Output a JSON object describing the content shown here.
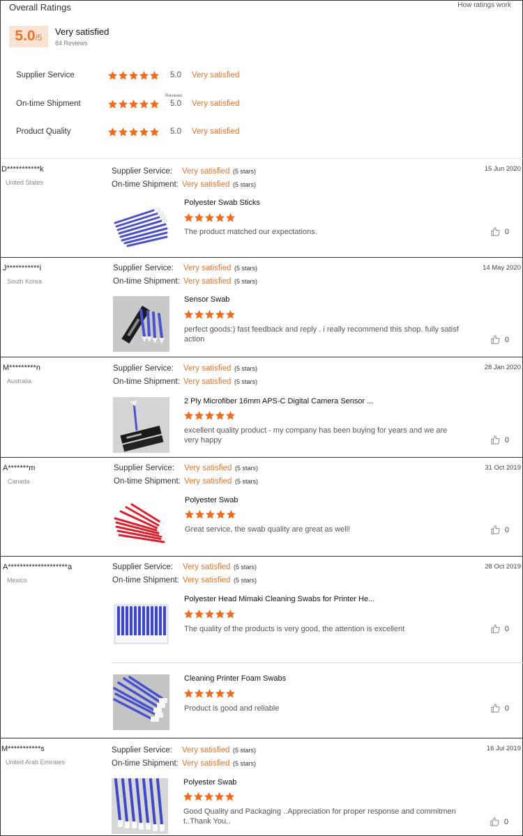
{
  "overall": {
    "title": "Overall Ratings",
    "help_link": "How ratings work",
    "score": "5.0",
    "score_of": "/5",
    "satisfaction": "Very satisfied",
    "review_count": "84 Reviews",
    "reviews_tooltip": "Reviews",
    "rating_fraction": 1.0,
    "categories": [
      {
        "label": "Supplier Service",
        "score": "5.0",
        "satisfaction": "Very satisfied",
        "rating": 5
      },
      {
        "label": "On-time Shipment",
        "score": "5.0",
        "satisfaction": "Very satisfied",
        "rating": 5
      },
      {
        "label": "Product Quality",
        "score": "5.0",
        "satisfaction": "Very satisfied",
        "rating": 5
      }
    ]
  },
  "colors": {
    "accent": "#e8732a",
    "star": "#f26b1d",
    "score_bg": "#fbe3d4"
  },
  "icons": {
    "star": "star-icon",
    "like": "thumbs-up-icon"
  },
  "sub_labels": {
    "supplier": "Supplier Service:",
    "shipment": "On-time Shipment:"
  },
  "reviews": [
    {
      "reviewer": "D***********k",
      "country": "United States",
      "date": "15 Jun 2020",
      "supplier_sat": "Very satisfied",
      "supplier_stars": "(5 stars)",
      "shipment_sat": "Very satisfied",
      "shipment_stars": "(5 stars)",
      "items": [
        {
          "title": "Polyester Swab Sticks",
          "rating": 5,
          "text": "The product matched our expectations.",
          "likes": "0"
        }
      ]
    },
    {
      "reviewer": "J***********i",
      "country": "South Korea",
      "date": "14 May 2020",
      "supplier_sat": "Very satisfied",
      "supplier_stars": "(5 stars)",
      "shipment_sat": "Very satisfied",
      "shipment_stars": "(5 stars)",
      "items": [
        {
          "title": "Sensor Swab",
          "rating": 5,
          "text": "perfect goods:) fast feedback and reply . i really recommend this shop. fully satisf action",
          "likes": "0"
        }
      ]
    },
    {
      "reviewer": "M*********n",
      "country": "Australia",
      "date": "28 Jan 2020",
      "supplier_sat": "Very satisfied",
      "supplier_stars": "(5 stars)",
      "shipment_sat": "Very satisfied",
      "shipment_stars": "(5 stars)",
      "items": [
        {
          "title": "2 Ply Microfiber 16mm APS-C Digital Camera Sensor ...",
          "rating": 5,
          "text": "excellent quality product - my company has been buying for years and we are very happy",
          "likes": "0"
        }
      ]
    },
    {
      "reviewer": "A*******m",
      "country": "Canada",
      "date": "31 Oct 2019",
      "supplier_sat": "Very satisfied",
      "supplier_stars": "(5 stars)",
      "shipment_sat": "Very satisfied",
      "shipment_stars": "(5 stars)",
      "items": [
        {
          "title": "Polyester Swab",
          "rating": 5,
          "text": "Great service, the swab quality are great as well!",
          "likes": "0"
        }
      ]
    },
    {
      "reviewer": "A********************a",
      "country": "Mexico",
      "date": "28 Oct 2019",
      "supplier_sat": "Very satisfied",
      "supplier_stars": "(5 stars)",
      "shipment_sat": "Very satisfied",
      "shipment_stars": "(5 stars)",
      "items": [
        {
          "title": "Polyester Head Mimaki Cleaning Swabs for Printer He...",
          "rating": 5,
          "text": "The quality of the products is very good, the attention is excellent",
          "likes": "0"
        },
        {
          "title": "Cleaning Printer Foam Swabs",
          "rating": 5,
          "text": "Product is good and reliable",
          "likes": "0"
        }
      ]
    },
    {
      "reviewer": "M***********s",
      "country": "United Arab Emirates",
      "date": "16 Jul 2019",
      "supplier_sat": "Very satisfied",
      "supplier_stars": "(5 stars)",
      "shipment_sat": "Very satisfied",
      "shipment_stars": "(5 stars)",
      "items": [
        {
          "title": "Polyester Swab",
          "rating": 5,
          "text": "Good Quality and Packaging ..Appreciation for proper response and commitmen t..Thank You..",
          "likes": "0"
        }
      ]
    }
  ]
}
